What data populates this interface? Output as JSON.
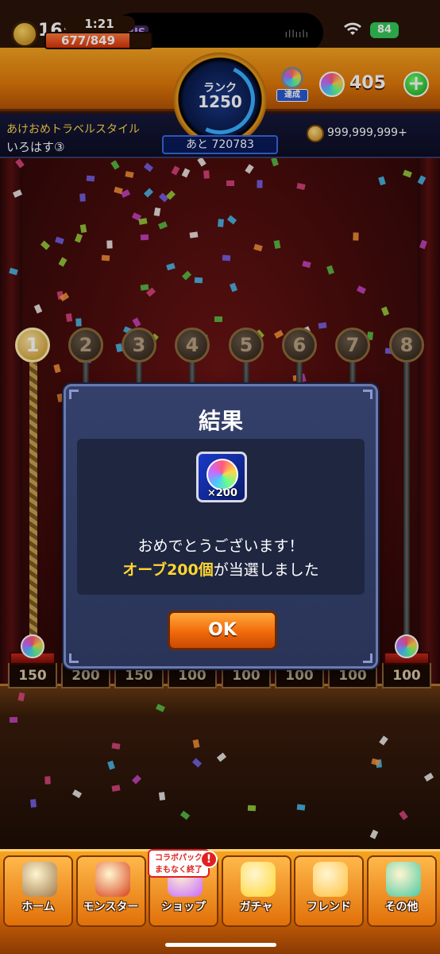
{
  "status": {
    "time": "16:20",
    "island_logo": "RJS",
    "battery": "84"
  },
  "header": {
    "stamina_timer": "1:21",
    "stamina": "677/849",
    "stamina_fraction": 0.797,
    "rank_label": "ランク",
    "rank_value": "1250",
    "achieve_label": "達成",
    "orb_count": "405",
    "plus_label": "+",
    "user_title": "あけおめトラベルスタイル",
    "user_name": "いろはす③",
    "next_rank": "あと 720783",
    "coins": "999,999,999+"
  },
  "stage": {
    "numbers": [
      "1",
      "2",
      "3",
      "4",
      "5",
      "6",
      "7",
      "8"
    ],
    "active_number": "1",
    "prizes": [
      "150",
      "200",
      "150",
      "100",
      "100",
      "100",
      "100",
      "100"
    ]
  },
  "dialog": {
    "title": "結果",
    "reward_qty": "×200",
    "message_line1": "おめでとうございます！",
    "message_highlight": "オーブ200個",
    "message_rest": "が当選しました",
    "ok_label": "OK"
  },
  "bottom_nav": {
    "items": [
      {
        "label": "ホーム",
        "icon": "home-icon"
      },
      {
        "label": "モンスター",
        "icon": "monster-icon"
      },
      {
        "label": "ショップ",
        "icon": "shop-icon"
      },
      {
        "label": "ガチャ",
        "icon": "gacha-icon"
      },
      {
        "label": "フレンド",
        "icon": "friend-icon"
      },
      {
        "label": "その他",
        "icon": "other-icon"
      }
    ],
    "shop_badge_line1": "コラボパック",
    "shop_badge_line2": "まもなく終了",
    "alert": "!"
  },
  "colors": {
    "accent_orange": "#f06a0a",
    "highlight_yellow": "#ffd530",
    "dialog_bg": "#2a3458"
  }
}
